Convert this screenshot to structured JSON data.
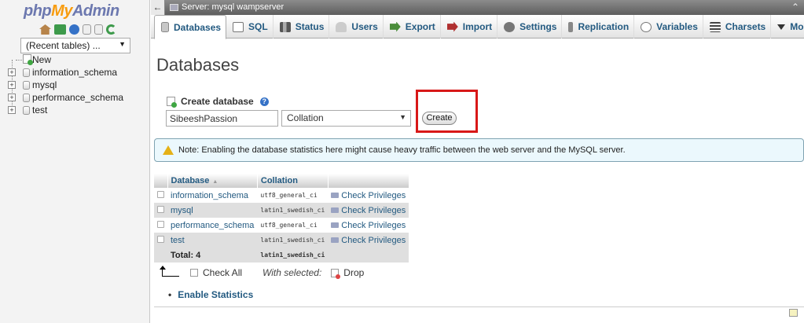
{
  "logo": {
    "php": "php",
    "my": "My",
    "admin": "Admin"
  },
  "nav_icons": [
    "home-icon",
    "exit-icon",
    "help-icon",
    "docs-icon",
    "settings-doc-icon",
    "reload-icon"
  ],
  "recent_tables": "(Recent tables) ...",
  "tree": {
    "new_label": "New",
    "databases": [
      "information_schema",
      "mysql",
      "performance_schema",
      "test"
    ]
  },
  "server_bar": {
    "back": "←",
    "title": "Server: mysql wampserver",
    "collapse": "⌃"
  },
  "tabs": [
    {
      "label": "Databases",
      "icon": "database-icon",
      "active": true
    },
    {
      "label": "SQL",
      "icon": "sql-icon"
    },
    {
      "label": "Status",
      "icon": "status-icon"
    },
    {
      "label": "Users",
      "icon": "users-icon"
    },
    {
      "label": "Export",
      "icon": "export-icon"
    },
    {
      "label": "Import",
      "icon": "import-icon"
    },
    {
      "label": "Settings",
      "icon": "settings-icon"
    },
    {
      "label": "Replication",
      "icon": "replication-icon"
    },
    {
      "label": "Variables",
      "icon": "variables-icon"
    },
    {
      "label": "Charsets",
      "icon": "charsets-icon"
    },
    {
      "label": "More",
      "icon": "more-icon"
    }
  ],
  "page_title": "Databases",
  "create_db": {
    "label": "Create database",
    "name_value": "SibeeshPassion",
    "collation_value": "Collation",
    "button_label": "Create",
    "help": "?"
  },
  "note": "Note: Enabling the database statistics here might cause heavy traffic between the web server and the MySQL server.",
  "table": {
    "headers": {
      "database": "Database",
      "sort": "▲",
      "collation": "Collation"
    },
    "rows": [
      {
        "name": "information_schema",
        "collation": "utf8_general_ci",
        "action": "Check Privileges"
      },
      {
        "name": "mysql",
        "collation": "latin1_swedish_ci",
        "action": "Check Privileges"
      },
      {
        "name": "performance_schema",
        "collation": "utf8_general_ci",
        "action": "Check Privileges"
      },
      {
        "name": "test",
        "collation": "latin1_swedish_ci",
        "action": "Check Privileges"
      }
    ],
    "total_label": "Total: 4",
    "total_collation": "latin1_swedish_ci"
  },
  "footer": {
    "check_all": "Check All",
    "with_selected": "With selected:",
    "drop": "Drop",
    "enable_stats": "Enable Statistics",
    "bullet": "•"
  }
}
